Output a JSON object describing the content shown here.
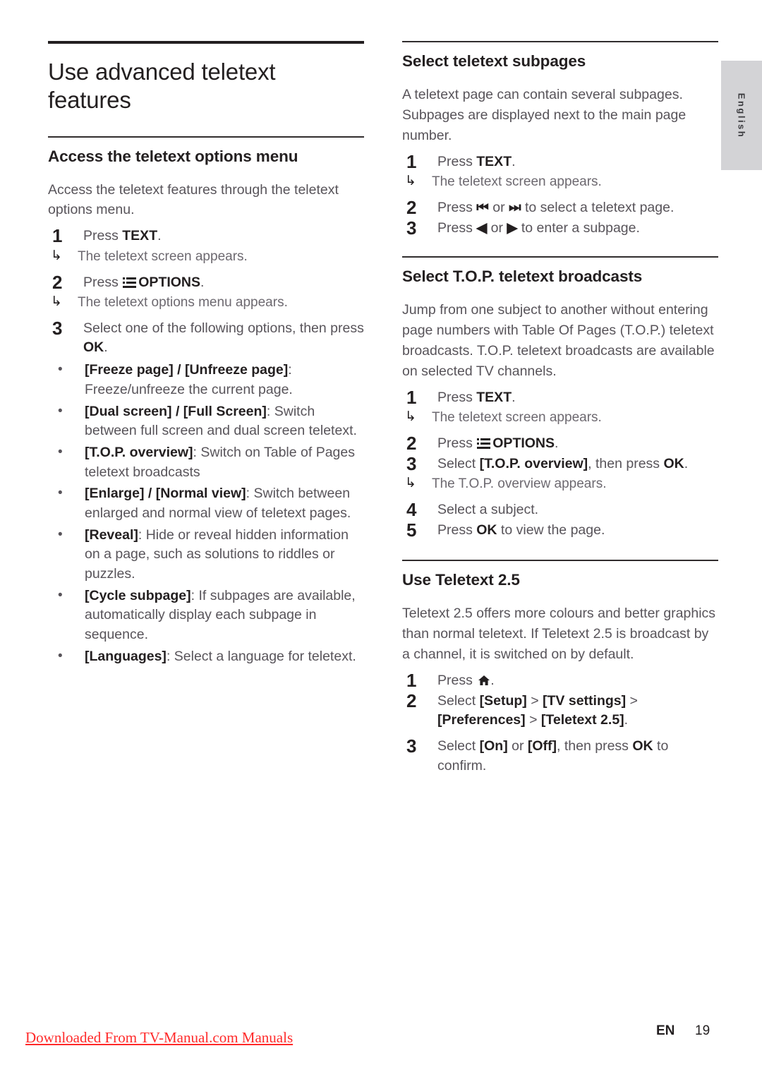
{
  "page": {
    "language_tab": "English",
    "footer": {
      "watermark": "Downloaded From TV-Manual.com Manuals",
      "lang_code": "EN",
      "page_number": "19"
    }
  },
  "left_column": {
    "doc_title": "Use advanced teletext features",
    "section": {
      "heading": "Access the teletext options menu",
      "intro": "Access the teletext features through the teletext options menu.",
      "steps": [
        {
          "num": "1",
          "text_before": "Press ",
          "keyword": "TEXT",
          "text_after": ".",
          "result_arrow": "↳",
          "result": "The teletext screen appears."
        },
        {
          "num": "2",
          "text_before": "Press ",
          "icon": "options-list-icon",
          "keyword": "OPTIONS",
          "text_after": ".",
          "result_arrow": "↳",
          "result": "The teletext options menu appears."
        },
        {
          "num": "3",
          "text_before": "Select one of the following options, then press ",
          "keyword": "OK",
          "text_after": "."
        }
      ],
      "bullet_marker": "•",
      "bullets": [
        {
          "label": "[Freeze page] / [Unfreeze page]",
          "desc": ": Freeze/unfreeze the current page."
        },
        {
          "label": "[Dual screen] / [Full Screen]",
          "desc": ": Switch between full screen and dual screen teletext."
        },
        {
          "label": "[T.O.P. overview]",
          "desc": ": Switch on Table of Pages teletext broadcasts"
        },
        {
          "label": "[Enlarge] / [Normal view]",
          "desc": ": Switch between enlarged and normal view of teletext pages."
        },
        {
          "label": "[Reveal]",
          "desc": ": Hide or reveal hidden information on a page, such as solutions to riddles or puzzles."
        },
        {
          "label": "[Cycle subpage]",
          "desc": ": If subpages are available, automatically display each subpage in sequence."
        },
        {
          "label": "[Languages]",
          "desc": ": Select a language for teletext."
        }
      ]
    }
  },
  "right_column": {
    "subpages": {
      "heading": "Select teletext subpages",
      "intro": "A teletext page can contain several subpages. Subpages are displayed next to the main page number.",
      "steps": [
        {
          "num": "1",
          "text_before": "Press ",
          "keyword": "TEXT",
          "text_after": ".",
          "result_arrow": "↳",
          "result": "The teletext screen appears."
        },
        {
          "num": "2",
          "text_before": "Press ",
          "glyph_a": "⏮",
          "text_mid": " or ",
          "glyph_b": "⏭",
          "text_after": " to select a teletext page."
        },
        {
          "num": "3",
          "text_before": "Press ",
          "glyph_a": "◀",
          "text_mid": " or ",
          "glyph_b": "▶",
          "text_after": " to enter a subpage."
        }
      ]
    },
    "top_broadcasts": {
      "heading": "Select T.O.P. teletext broadcasts",
      "intro": "Jump from one subject to another without entering page numbers with Table Of Pages (T.O.P.) teletext broadcasts. T.O.P. teletext broadcasts are available on selected TV channels.",
      "steps": [
        {
          "num": "1",
          "text_before": "Press ",
          "keyword": "TEXT",
          "text_after": ".",
          "result_arrow": "↳",
          "result": "The teletext screen appears."
        },
        {
          "num": "2",
          "text_before": "Press ",
          "icon": "options-list-icon",
          "keyword": "OPTIONS",
          "text_after": "."
        },
        {
          "num": "3",
          "text_before": "Select ",
          "keyword": "[T.O.P. overview]",
          "text_mid": ", then press ",
          "keyword_b": "OK",
          "text_after": ".",
          "result_arrow": "↳",
          "result": "The T.O.P. overview appears."
        },
        {
          "num": "4",
          "text_before": "Select a subject."
        },
        {
          "num": "5",
          "text_before": "Press ",
          "keyword": "OK",
          "text_after": " to view the page."
        }
      ]
    },
    "teletext25": {
      "heading": "Use Teletext 2.5",
      "intro": "Teletext 2.5 offers more colours and better graphics than normal teletext. If Teletext 2.5 is broadcast by a channel, it is switched on by default.",
      "steps": [
        {
          "num": "1",
          "text_before": "Press ",
          "icon": "home-icon",
          "text_after": "."
        },
        {
          "num": "2",
          "text_before": "Select ",
          "keyword": "[Setup]",
          "sep1": " > ",
          "keyword_b": "[TV settings]",
          "sep2": " > ",
          "keyword_c": "[Preferences]",
          "sep3": " > ",
          "keyword_d": "[Teletext 2.5]",
          "text_after": "."
        },
        {
          "num": "3",
          "text_before": "Select ",
          "keyword": "[On]",
          "text_mid": " or ",
          "keyword_b": "[Off]",
          "text_after2": ", then press ",
          "keyword_c": "OK",
          "text_after": " to confirm."
        }
      ]
    }
  }
}
